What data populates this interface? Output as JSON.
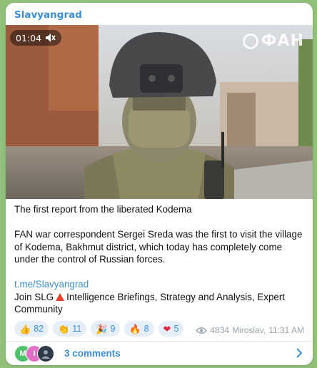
{
  "post": {
    "channel_name": "Slavyangrad",
    "video": {
      "duration": "01:04",
      "watermark": "ФАН"
    },
    "title_line": "The first report from the liberated Kodema",
    "body": "FAN war correspondent Sergei Sreda was the first to visit the village of Kodema, Bakhmut district, which today has completely come under the control of Russian forces.",
    "link": "t.me/Slavyangrad",
    "join_prefix": "Join SLG",
    "join_suffix": "Intelligence Briefings, Strategy and Analysis, Expert Community",
    "reactions": [
      {
        "emoji": "👍",
        "icon": "thumbs-up-icon",
        "count": "82"
      },
      {
        "emoji": "👏",
        "icon": "clapping-icon",
        "count": "11"
      },
      {
        "emoji": "🎉",
        "icon": "party-popper-icon",
        "count": "9"
      },
      {
        "emoji": "🔥",
        "icon": "fire-icon",
        "count": "8"
      },
      {
        "emoji": "❤",
        "icon": "heart-icon",
        "count": "5"
      }
    ],
    "views": "4834",
    "author": "Miroslav,",
    "time": "11:31 AM",
    "comments": {
      "label": "3 comments",
      "avatars": [
        {
          "initial": "M",
          "color": "#4cc06a"
        },
        {
          "initial": "I",
          "color": "#e06fc7"
        },
        {
          "initial": "",
          "color": "#2f3a44"
        }
      ]
    }
  },
  "colors": {
    "accent": "#3a8fd6",
    "background": "#8fbf79",
    "reaction_bg": "#e6eff9",
    "meta": "#9aa3ad"
  }
}
